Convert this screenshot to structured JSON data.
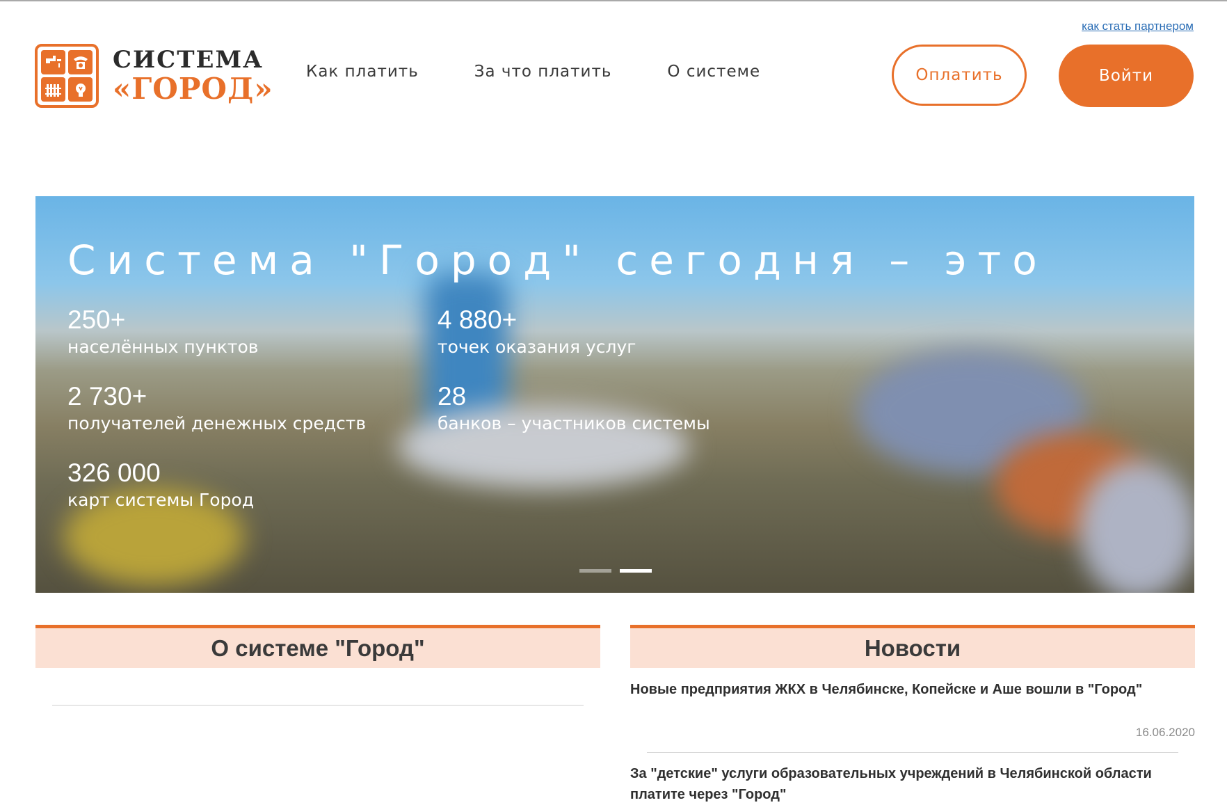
{
  "header": {
    "partner_link": "как стать партнером",
    "logo_line1": "СИСТЕМА",
    "logo_line2": "«ГОРОД»",
    "nav": [
      "Как платить",
      "За что платить",
      "О системе"
    ],
    "pay_button": "Оплатить",
    "login_button": "Войти"
  },
  "hero": {
    "title": "Система \"Город\" сегодня – это",
    "stats": [
      {
        "value": "250+",
        "label": "населённых пунктов"
      },
      {
        "value": "4 880+",
        "label": "точек оказания услуг"
      },
      {
        "value": "2 730+",
        "label": "получателей денежных средств"
      },
      {
        "value": "28",
        "label": "банков – участников системы"
      },
      {
        "value": "326 000",
        "label": "карт системы Город"
      }
    ],
    "slides_count": 2,
    "active_slide": 2
  },
  "about": {
    "title": "О системе \"Город\""
  },
  "news": {
    "title": "Новости",
    "items": [
      {
        "title": "Новые предприятия ЖКХ в Челябинске, Копейске и Аше вошли в \"Город\"",
        "date": "16.06.2020"
      },
      {
        "title": "За \"детские\" услуги образовательных учреждений в Челябинской области платите через \"Город\"",
        "date": ""
      }
    ]
  },
  "colors": {
    "accent": "#e8702a",
    "panel_bg": "#fbe0d3",
    "link": "#2a6db5"
  }
}
